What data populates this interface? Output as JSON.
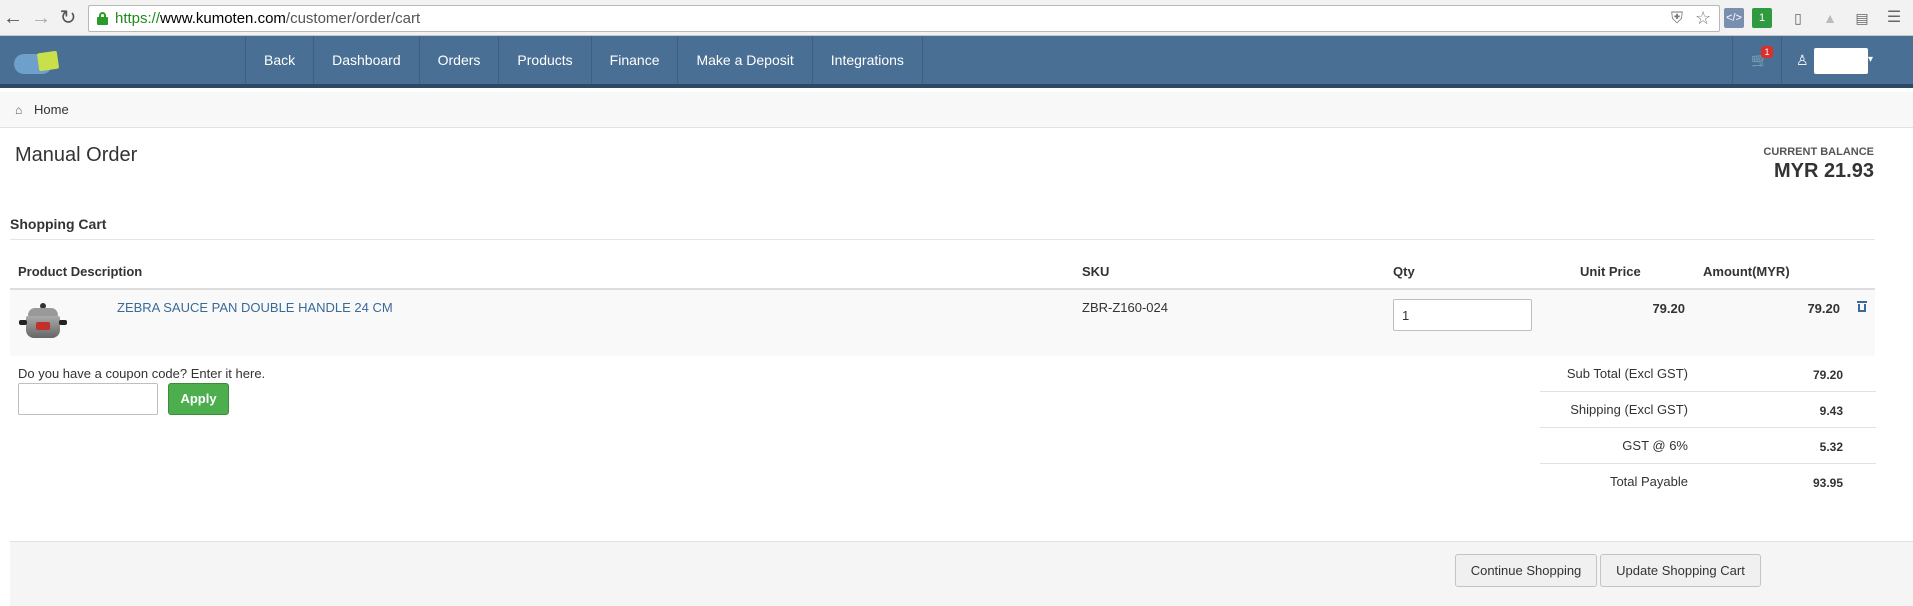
{
  "browser": {
    "url_scheme": "https://",
    "url_host": "www.kumoten.com",
    "url_path": "/customer/order/cart"
  },
  "header": {
    "nav": [
      "Back",
      "Dashboard",
      "Orders",
      "Products",
      "Finance",
      "Make a Deposit",
      "Integrations"
    ],
    "cart_count": "1"
  },
  "breadcrumb": {
    "home": "Home"
  },
  "page": {
    "title": "Manual Order",
    "balance_label": "CURRENT BALANCE",
    "balance_value": "MYR 21.93"
  },
  "cart": {
    "heading": "Shopping Cart",
    "columns": {
      "product": "Product Description",
      "sku": "SKU",
      "qty": "Qty",
      "unit_price": "Unit Price",
      "amount": "Amount(MYR)"
    },
    "items": [
      {
        "name": "ZEBRA SAUCE PAN DOUBLE HANDLE 24 CM",
        "sku": "ZBR-Z160-024",
        "qty": "1",
        "unit_price": "79.20",
        "amount": "79.20"
      }
    ]
  },
  "coupon": {
    "label": "Do you have a coupon code? Enter it here.",
    "value": "",
    "apply_label": "Apply"
  },
  "totals": [
    {
      "label": "Sub Total (Excl GST)",
      "value": "79.20"
    },
    {
      "label": "Shipping (Excl GST)",
      "value": "9.43"
    },
    {
      "label": "GST @ 6%",
      "value": "5.32"
    },
    {
      "label": "Total Payable",
      "value": "93.95"
    }
  ],
  "actions": {
    "continue": "Continue Shopping",
    "update": "Update Shopping Cart"
  }
}
